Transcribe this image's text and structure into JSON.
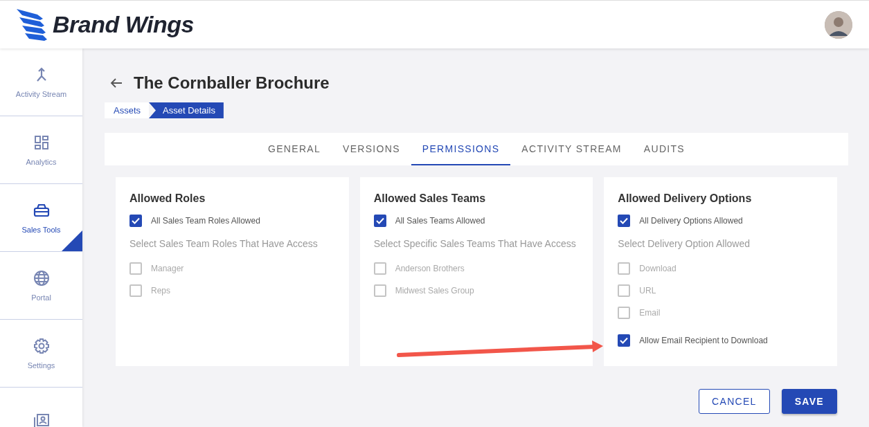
{
  "header": {
    "brand": "Brand Wings"
  },
  "sidebar": {
    "items": [
      {
        "label": "Activity Stream",
        "selected": false
      },
      {
        "label": "Analytics",
        "selected": false
      },
      {
        "label": "Sales Tools",
        "selected": true
      },
      {
        "label": "Portal",
        "selected": false
      },
      {
        "label": "Settings",
        "selected": false
      },
      {
        "selected": false
      }
    ]
  },
  "page": {
    "title": "The Cornballer Brochure"
  },
  "breadcrumb": [
    {
      "label": "Assets",
      "selected": false
    },
    {
      "label": "Asset Details",
      "selected": true
    }
  ],
  "tabs": [
    {
      "label": "GENERAL",
      "selected": false
    },
    {
      "label": "VERSIONS",
      "selected": false
    },
    {
      "label": "PERMISSIONS",
      "selected": true
    },
    {
      "label": "ACTIVITY STREAM",
      "selected": false
    },
    {
      "label": "AUDITS",
      "selected": false
    }
  ],
  "cards": [
    {
      "title": "Allowed Roles",
      "all_option": {
        "label": "All Sales Team Roles Allowed",
        "checked": true
      },
      "section_label": "Select Sales Team Roles That Have Access",
      "options": [
        {
          "label": "Manager",
          "checked": false,
          "disabled": true
        },
        {
          "label": "Reps",
          "checked": false,
          "disabled": true
        }
      ]
    },
    {
      "title": "Allowed Sales Teams",
      "all_option": {
        "label": "All Sales Teams Allowed",
        "checked": true
      },
      "section_label": "Select Specific Sales Teams That Have Access",
      "options": [
        {
          "label": "Anderson Brothers",
          "checked": false,
          "disabled": true
        },
        {
          "label": "Midwest Sales Group",
          "checked": false,
          "disabled": true
        }
      ]
    },
    {
      "title": "Allowed Delivery Options",
      "all_option": {
        "label": "All Delivery Options Allowed",
        "checked": true
      },
      "section_label": "Select Delivery Option Allowed",
      "options": [
        {
          "label": "Download",
          "checked": false,
          "disabled": true
        },
        {
          "label": "URL",
          "checked": false,
          "disabled": true
        },
        {
          "label": "Email",
          "checked": false,
          "disabled": true
        }
      ],
      "extra_option": {
        "label": "Allow Email Recipient to Download",
        "checked": true
      }
    }
  ],
  "buttons": [
    {
      "label": "CANCEL",
      "kind": "outline"
    },
    {
      "label": "SAVE",
      "kind": "primary"
    }
  ]
}
